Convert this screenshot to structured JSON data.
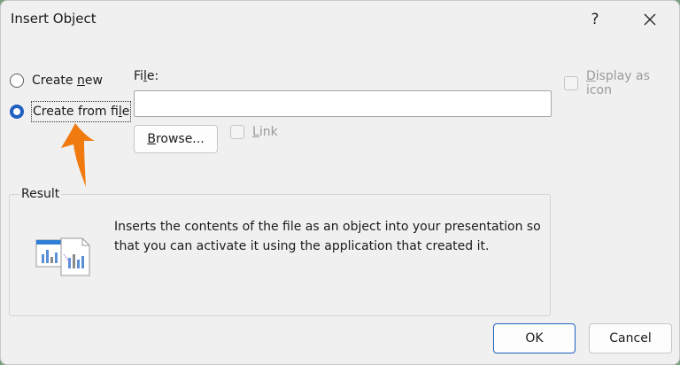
{
  "window": {
    "title": "Insert Object",
    "help_label": "?"
  },
  "options": {
    "create_new": {
      "before": "Create ",
      "accel": "n",
      "after": "ew",
      "selected": false
    },
    "create_from_file": {
      "before": "Create from fi",
      "accel": "l",
      "after": "e",
      "selected": true
    }
  },
  "file": {
    "label_before": "Fi",
    "label_accel": "l",
    "label_after": "e:",
    "value": "",
    "placeholder": ""
  },
  "browse": {
    "accel": "B",
    "after": "rowse..."
  },
  "link": {
    "accel": "L",
    "after": "ink",
    "checked": false
  },
  "display_as_icon": {
    "accel": "D",
    "after": "isplay as icon",
    "checked": false
  },
  "result": {
    "label": "Result",
    "description": "Inserts the contents of the file as an object into your presentation so that you can activate it using the application that created it."
  },
  "buttons": {
    "ok": "OK",
    "cancel": "Cancel"
  },
  "colors": {
    "accent": "#1f5fbf",
    "annotation_arrow": "#f07a10",
    "dialog_bg": "#f0f0f0"
  },
  "icons": {
    "close": "close-icon",
    "object": "embedded-object-icon",
    "annotation": "annotation-arrow-icon"
  }
}
